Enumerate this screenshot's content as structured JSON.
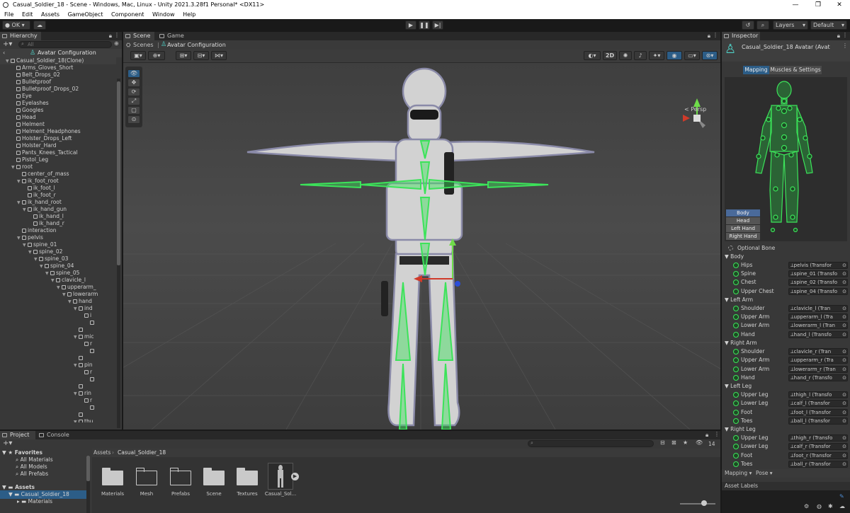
{
  "window": {
    "title": "Casual_Soldier_18 - Scene - Windows, Mac, Linux - Unity 2021.3.28f1 Personal* <DX11>"
  },
  "menu": [
    "File",
    "Edit",
    "Assets",
    "GameObject",
    "Component",
    "Window",
    "Help"
  ],
  "toolbar": {
    "account_label": "OK",
    "layers_label": "Layers",
    "layout_label": "Default"
  },
  "hierarchy": {
    "tab_label": "Hierarchy",
    "search_placeholder": "All",
    "context_title": "Avatar Configuration",
    "rows": [
      {
        "label": "Casual_Soldier_18(Clone)",
        "depth": 0,
        "arrow": "▼"
      },
      {
        "label": "Arms_Gloves_Short",
        "depth": 1,
        "arrow": ""
      },
      {
        "label": "Belt_Drops_02",
        "depth": 1,
        "arrow": ""
      },
      {
        "label": "Bulletproof",
        "depth": 1,
        "arrow": ""
      },
      {
        "label": "Bulletproof_Drops_02",
        "depth": 1,
        "arrow": ""
      },
      {
        "label": "Eye",
        "depth": 1,
        "arrow": ""
      },
      {
        "label": "Eyelashes",
        "depth": 1,
        "arrow": ""
      },
      {
        "label": "Googles",
        "depth": 1,
        "arrow": ""
      },
      {
        "label": "Head",
        "depth": 1,
        "arrow": ""
      },
      {
        "label": "Helment",
        "depth": 1,
        "arrow": ""
      },
      {
        "label": "Helment_Headphones",
        "depth": 1,
        "arrow": ""
      },
      {
        "label": "Holster_Drops_Left",
        "depth": 1,
        "arrow": ""
      },
      {
        "label": "Holster_Hard",
        "depth": 1,
        "arrow": ""
      },
      {
        "label": "Pants_Knees_Tactical",
        "depth": 1,
        "arrow": ""
      },
      {
        "label": "Pistol_Leg",
        "depth": 1,
        "arrow": ""
      },
      {
        "label": "root",
        "depth": 1,
        "arrow": "▼"
      },
      {
        "label": "center_of_mass",
        "depth": 2,
        "arrow": ""
      },
      {
        "label": "ik_foot_root",
        "depth": 2,
        "arrow": "▼"
      },
      {
        "label": "ik_foot_l",
        "depth": 3,
        "arrow": ""
      },
      {
        "label": "ik_foot_r",
        "depth": 3,
        "arrow": ""
      },
      {
        "label": "ik_hand_root",
        "depth": 2,
        "arrow": "▼"
      },
      {
        "label": "ik_hand_gun",
        "depth": 3,
        "arrow": "▼"
      },
      {
        "label": "ik_hand_l",
        "depth": 4,
        "arrow": ""
      },
      {
        "label": "ik_hand_r",
        "depth": 4,
        "arrow": ""
      },
      {
        "label": "interaction",
        "depth": 2,
        "arrow": ""
      },
      {
        "label": "pelvis",
        "depth": 2,
        "arrow": "▼"
      },
      {
        "label": "spine_01",
        "depth": 3,
        "arrow": "▼"
      },
      {
        "label": "spine_02",
        "depth": 4,
        "arrow": "▼"
      },
      {
        "label": "spine_03",
        "depth": 5,
        "arrow": "▼"
      },
      {
        "label": "spine_04",
        "depth": 6,
        "arrow": "▼"
      },
      {
        "label": "spine_05",
        "depth": 7,
        "arrow": "▼"
      },
      {
        "label": "clavicle_l",
        "depth": 8,
        "arrow": "▼"
      },
      {
        "label": "upperarm_",
        "depth": 9,
        "arrow": "▼"
      },
      {
        "label": "lowerarm",
        "depth": 10,
        "arrow": "▼"
      },
      {
        "label": "hand",
        "depth": 11,
        "arrow": "▼"
      },
      {
        "label": "ind",
        "depth": 12,
        "arrow": "▼"
      },
      {
        "label": "i",
        "depth": 13,
        "arrow": ""
      },
      {
        "label": "",
        "depth": 14,
        "arrow": ""
      },
      {
        "label": "",
        "depth": 12,
        "arrow": ""
      },
      {
        "label": "mic",
        "depth": 12,
        "arrow": "▼"
      },
      {
        "label": "r",
        "depth": 13,
        "arrow": ""
      },
      {
        "label": "",
        "depth": 14,
        "arrow": ""
      },
      {
        "label": "",
        "depth": 12,
        "arrow": ""
      },
      {
        "label": "pin",
        "depth": 12,
        "arrow": "▼"
      },
      {
        "label": "r",
        "depth": 13,
        "arrow": ""
      },
      {
        "label": "",
        "depth": 14,
        "arrow": ""
      },
      {
        "label": "",
        "depth": 12,
        "arrow": ""
      },
      {
        "label": "rin",
        "depth": 12,
        "arrow": "▼"
      },
      {
        "label": "r",
        "depth": 13,
        "arrow": ""
      },
      {
        "label": "",
        "depth": 14,
        "arrow": ""
      },
      {
        "label": "",
        "depth": 12,
        "arrow": ""
      },
      {
        "label": "thu",
        "depth": 12,
        "arrow": "▼"
      }
    ]
  },
  "scene": {
    "tabs": [
      "Scene",
      "Game"
    ],
    "breadcrumb": {
      "root": "Scenes",
      "current": "Avatar Configuration"
    },
    "view_2d_label": "2D",
    "gizmo_label": "< Persp"
  },
  "inspector": {
    "tab_label": "Inspector",
    "title": "Casual_Soldier_18 Avatar (Avat",
    "tabs": [
      "Mapping",
      "Muscles & Settings"
    ],
    "body_part_buttons": [
      "Body",
      "Head",
      "Left Hand",
      "Right Hand"
    ],
    "optional_bone_label": "Optional Bone",
    "groups": [
      {
        "name": "Body",
        "bones": [
          {
            "name": "Hips",
            "value": "pelvis (Transfor"
          },
          {
            "name": "Spine",
            "value": "spine_01 (Transfo"
          },
          {
            "name": "Chest",
            "value": "spine_02 (Transfo"
          },
          {
            "name": "Upper Chest",
            "value": "spine_04 (Transfo"
          }
        ]
      },
      {
        "name": "Left Arm",
        "bones": [
          {
            "name": "Shoulder",
            "value": "clavicle_l (Tran"
          },
          {
            "name": "Upper Arm",
            "value": "upperarm_l (Tra"
          },
          {
            "name": "Lower Arm",
            "value": "lowerarm_l (Tran"
          },
          {
            "name": "Hand",
            "value": "hand_l (Transfo"
          }
        ]
      },
      {
        "name": "Right Arm",
        "bones": [
          {
            "name": "Shoulder",
            "value": "clavicle_r (Tran"
          },
          {
            "name": "Upper Arm",
            "value": "upperarm_r (Tra"
          },
          {
            "name": "Lower Arm",
            "value": "lowerarm_r (Tran"
          },
          {
            "name": "Hand",
            "value": "hand_r (Transfo"
          }
        ]
      },
      {
        "name": "Left Leg",
        "bones": [
          {
            "name": "Upper Leg",
            "value": "thigh_l (Transfo"
          },
          {
            "name": "Lower Leg",
            "value": "calf_l (Transfor"
          },
          {
            "name": "Foot",
            "value": "foot_l (Transfor"
          },
          {
            "name": "Toes",
            "value": "ball_l (Transfor"
          }
        ]
      },
      {
        "name": "Right Leg",
        "bones": [
          {
            "name": "Upper Leg",
            "value": "thigh_r (Transfo"
          },
          {
            "name": "Lower Leg",
            "value": "calf_r (Transfor"
          },
          {
            "name": "Foot",
            "value": "foot_r (Transfor"
          },
          {
            "name": "Toes",
            "value": "ball_r (Transfor"
          }
        ]
      }
    ],
    "footer_tabs": [
      "Mapping",
      "Pose"
    ],
    "asset_labels": "Asset Labels"
  },
  "project": {
    "tabs": [
      "Project",
      "Console"
    ],
    "favorites": {
      "label": "Favorites",
      "items": [
        "All Materials",
        "All Models",
        "All Prefabs"
      ]
    },
    "assets": {
      "label": "Assets",
      "items": [
        "Casual_Soldier_18",
        "Materials"
      ]
    },
    "breadcrumb": {
      "root": "Assets",
      "current": "Casual_Soldier_18"
    },
    "hidden_count": "14",
    "folders": [
      "Materials",
      "Mesh",
      "Prefabs",
      "Scene",
      "Textures",
      "Casual_Sol..."
    ]
  },
  "colors": {
    "bone_green": "#3ce35a",
    "selection_blue": "#2c5d87",
    "panel": "#383838"
  }
}
